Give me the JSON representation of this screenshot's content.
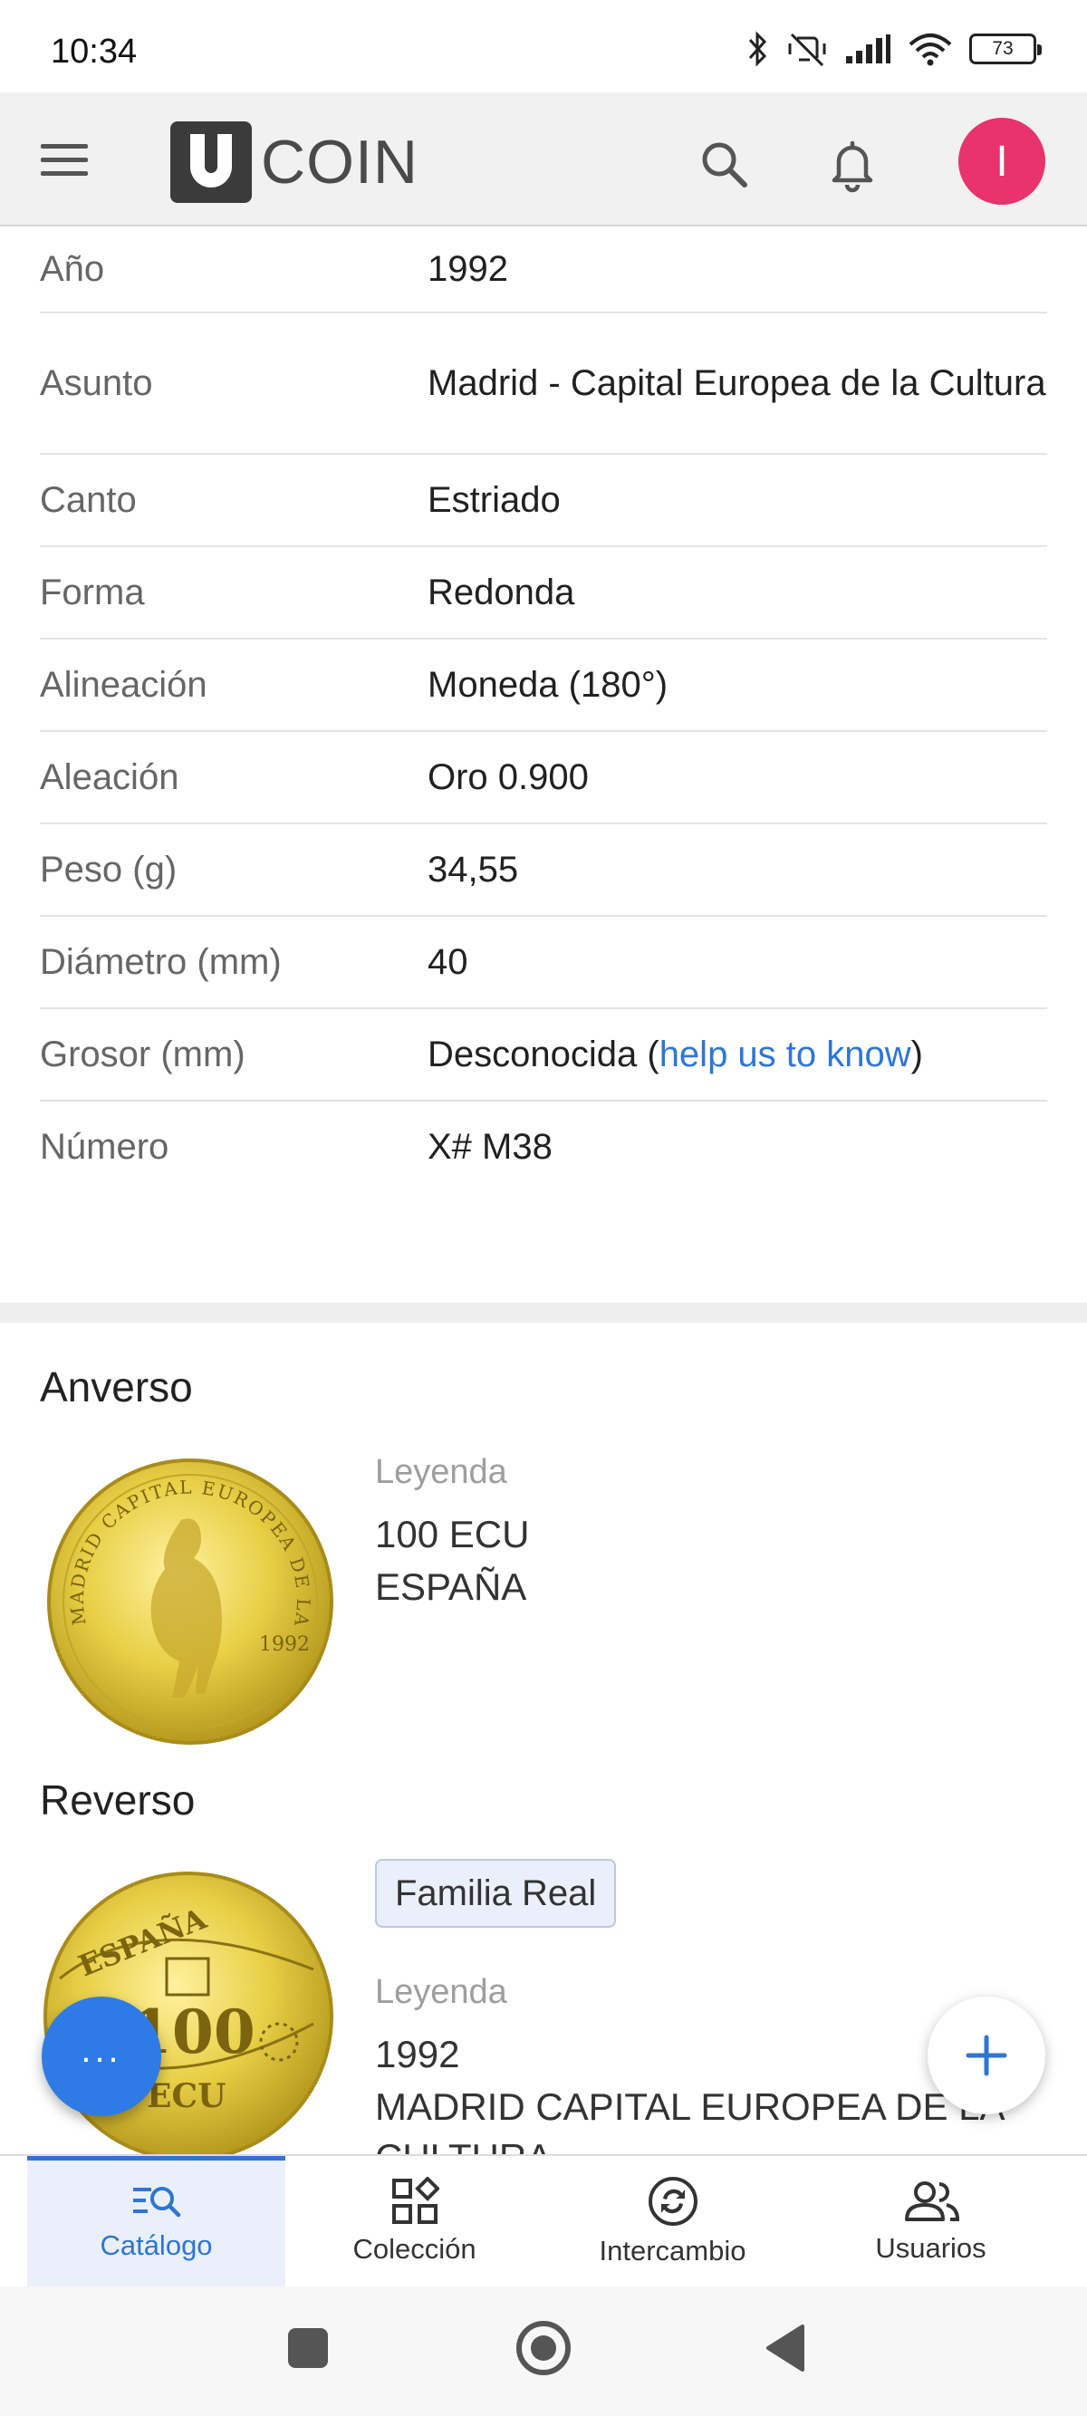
{
  "status_bar": {
    "time": "10:34",
    "battery": "73"
  },
  "app_bar": {
    "logo_letter": "U",
    "logo_text": "COIN",
    "avatar_initial": "I"
  },
  "specs": [
    {
      "label": "Año",
      "value": "1992"
    },
    {
      "label": "Asunto",
      "value": "Madrid - Capital Europea de la Cultura"
    },
    {
      "label": "Canto",
      "value": "Estriado"
    },
    {
      "label": "Forma",
      "value": "Redonda"
    },
    {
      "label": "Alineación",
      "value": "Moneda (180°)"
    },
    {
      "label": "Aleación",
      "value": "Oro 0.900"
    },
    {
      "label": "Peso (g)",
      "value": "34,55"
    },
    {
      "label": "Diámetro (mm)",
      "value": "40"
    },
    {
      "label": "Grosor (mm)",
      "value": "Desconocida (",
      "link": "help us to know",
      "suffix": ")"
    },
    {
      "label": "Número",
      "value": "X# M38"
    }
  ],
  "obverse": {
    "title": "Anverso",
    "legend_label": "Leyenda",
    "legend_lines": [
      "100 ECU",
      "ESPAÑA"
    ],
    "coin_inscription_top": "MADRID CAPITAL EUROPEA DE LA CULTURA",
    "coin_year": "1992"
  },
  "reverse": {
    "title": "Reverso",
    "tag": "Familia Real",
    "legend_label": "Leyenda",
    "legend_lines": [
      "1992",
      "MADRID CAPITAL EUROPEA DE LA",
      "CULTURA"
    ],
    "coin_text_top": "ESPAÑA",
    "coin_text_mid": "100",
    "coin_text_bottom": "ECU"
  },
  "fab": {
    "menu_label": "...",
    "add_label": "+"
  },
  "bottom_nav": [
    {
      "label": "Catálogo",
      "icon": "catalog-search-icon",
      "active": true
    },
    {
      "label": "Colección",
      "icon": "collection-grid-icon",
      "active": false
    },
    {
      "label": "Intercambio",
      "icon": "exchange-icon",
      "active": false
    },
    {
      "label": "Usuarios",
      "icon": "users-icon",
      "active": false
    }
  ],
  "colors": {
    "accent": "#2f76d2",
    "avatar": "#e8336d",
    "fab": "#2f7be5",
    "coin_gold": "#e3c83c"
  }
}
